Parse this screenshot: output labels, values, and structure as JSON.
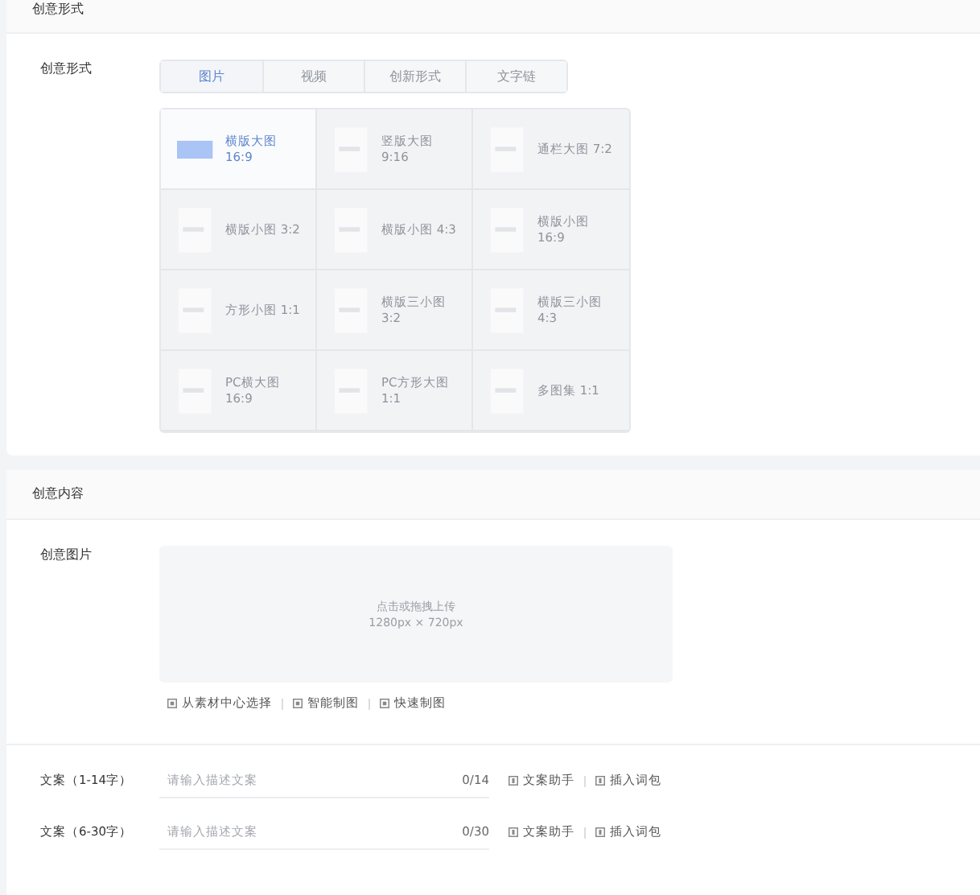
{
  "form_section": {
    "title": "创意形式",
    "label": "创意形式",
    "tabs": [
      {
        "label": "图片",
        "selected": true
      },
      {
        "label": "视频",
        "selected": false
      },
      {
        "label": "创新形式",
        "selected": false
      },
      {
        "label": "文字链",
        "selected": false
      }
    ],
    "styles": [
      {
        "name": "横版大图",
        "ratio": "16:9",
        "selected": true
      },
      {
        "name": "竖版大图",
        "ratio": "9:16",
        "selected": false
      },
      {
        "name": "通栏大图 7:2",
        "selected": false
      },
      {
        "name": "横版小图 3:2",
        "selected": false
      },
      {
        "name": "横版小图 4:3",
        "selected": false
      },
      {
        "name": "横版小图",
        "ratio": "16:9",
        "selected": false
      },
      {
        "name": "方形小图 1:1",
        "selected": false
      },
      {
        "name": "横版三小图",
        "ratio": "3:2",
        "selected": false
      },
      {
        "name": "横版三小图",
        "ratio": "4:3",
        "selected": false
      },
      {
        "name": "PC横大图",
        "ratio": "16:9",
        "selected": false
      },
      {
        "name": "PC方形大图",
        "ratio": "1:1",
        "selected": false
      },
      {
        "name": "多图集 1:1",
        "selected": false
      }
    ]
  },
  "content_section": {
    "title": "创意内容",
    "image_label": "创意图片",
    "upload": {
      "text": "点击或拖拽上传",
      "size": "1280px × 720px"
    },
    "upload_actions": [
      "从素材中心选择",
      "智能制图",
      "快速制图"
    ],
    "fields": [
      {
        "label": "文案（1-14字）",
        "placeholder": "请输入描述文案",
        "count": "0/14",
        "tools": [
          "文案助手",
          "插入词包"
        ]
      },
      {
        "label": "文案（6-30字）",
        "placeholder": "请输入描述文案",
        "count": "0/30",
        "tools": [
          "文案助手",
          "插入词包"
        ]
      }
    ]
  }
}
